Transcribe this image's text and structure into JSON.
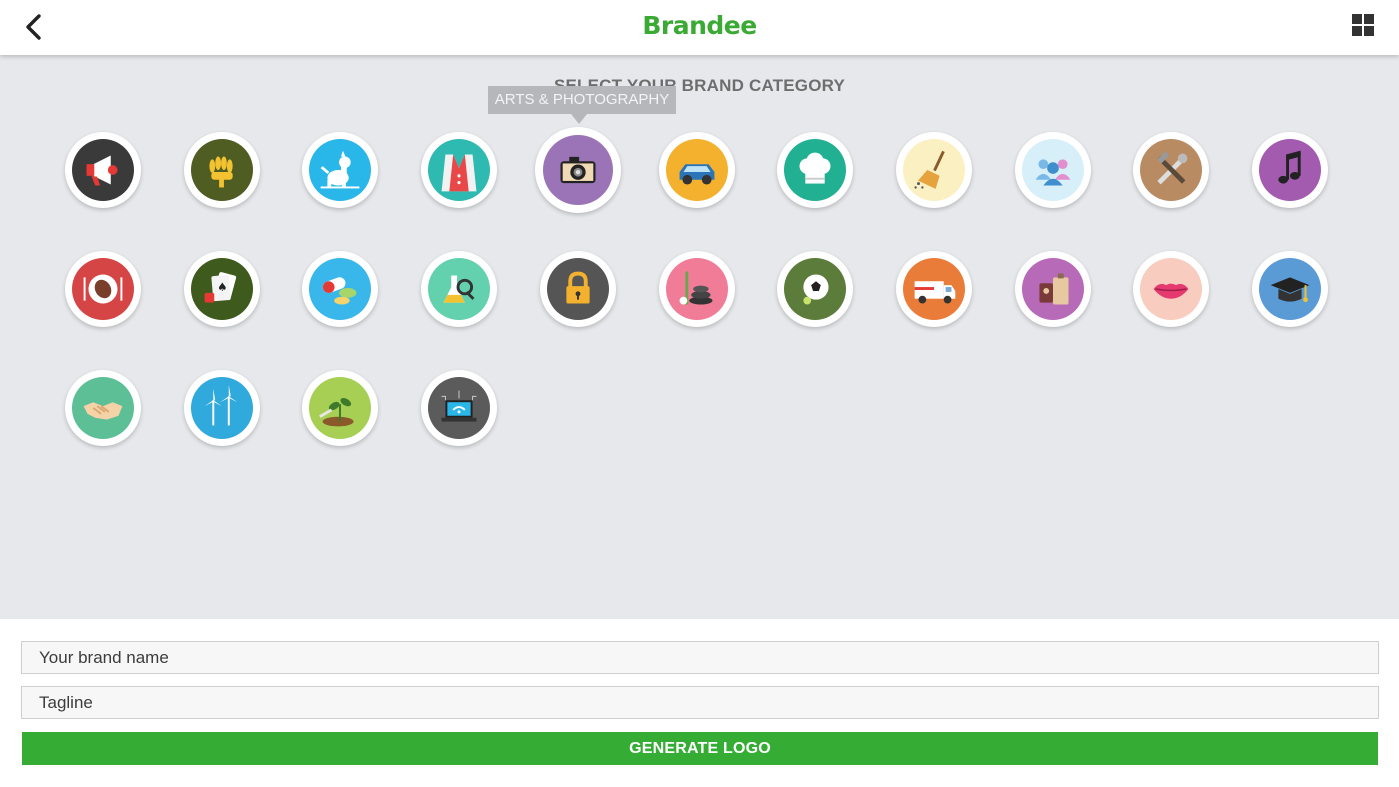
{
  "header": {
    "back_icon": "chevron-left-icon",
    "logo_text": "Brandee",
    "grid_icon": "grid-icon",
    "brand_color": "#3aaa35"
  },
  "category_panel": {
    "title": "SELECT YOUR BRAND CATEGORY",
    "tooltip": "ARTS & PHOTOGRAPHY",
    "selected_index": 4,
    "categories": [
      {
        "icon": "megaphone-icon",
        "color": "#3a3a3a"
      },
      {
        "icon": "wheat-icon",
        "color": "#4f5d22"
      },
      {
        "icon": "dog-icon",
        "color": "#29b7e9"
      },
      {
        "icon": "suit-vest-icon",
        "color": "#2ebab0"
      },
      {
        "icon": "camera-icon",
        "color": "#9a74b6"
      },
      {
        "icon": "car-icon",
        "color": "#f4b12e"
      },
      {
        "icon": "chef-hat-icon",
        "color": "#22b092"
      },
      {
        "icon": "broom-icon",
        "color": "#fbf0c2"
      },
      {
        "icon": "people-group-icon",
        "color": "#d7eff9"
      },
      {
        "icon": "tools-icon",
        "color": "#b88b63"
      },
      {
        "icon": "music-note-icon",
        "color": "#a35bb0"
      },
      {
        "icon": "food-plate-icon",
        "color": "#d64545"
      },
      {
        "icon": "playing-cards-icon",
        "color": "#3e5a1c"
      },
      {
        "icon": "pills-icon",
        "color": "#3ab7ea"
      },
      {
        "icon": "lab-flask-icon",
        "color": "#63d1ad"
      },
      {
        "icon": "padlock-icon",
        "color": "#555555"
      },
      {
        "icon": "spa-stones-icon",
        "color": "#f07c98"
      },
      {
        "icon": "soccer-ball-icon",
        "color": "#5b7c3a"
      },
      {
        "icon": "delivery-truck-icon",
        "color": "#ea7c3a"
      },
      {
        "icon": "travel-luggage-icon",
        "color": "#b76ab8"
      },
      {
        "icon": "lips-icon",
        "color": "#f8ccbe"
      },
      {
        "icon": "graduation-cap-icon",
        "color": "#5b9bd5"
      },
      {
        "icon": "handshake-icon",
        "color": "#5cbf96"
      },
      {
        "icon": "wind-turbine-icon",
        "color": "#30a9dd"
      },
      {
        "icon": "plant-sprout-icon",
        "color": "#a6cf54"
      },
      {
        "icon": "laptop-network-icon",
        "color": "#5b5b5b"
      }
    ]
  },
  "form": {
    "brand_name_placeholder": "Your brand name",
    "tagline_placeholder": "Tagline",
    "generate_label": "GENERATE LOGO",
    "button_color": "#35ad35"
  }
}
